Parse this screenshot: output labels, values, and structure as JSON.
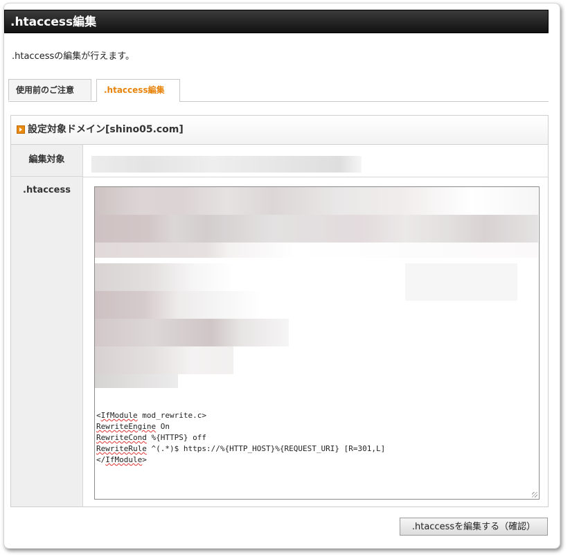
{
  "header": {
    "title": ".htaccess編集"
  },
  "description": ".htaccessの編集が行えます。",
  "tabs": [
    {
      "label": "使用前のご注意",
      "active": false
    },
    {
      "label": ".htaccess編集",
      "active": true
    }
  ],
  "panel": {
    "title": "設定対象ドメイン[shino05.com]",
    "rows": {
      "target_label": "編集対象",
      "htaccess_label": ".htaccess"
    }
  },
  "code": {
    "line1_tag": "IfModule",
    "line1_rest": " mod_rewrite.c>",
    "line2_kw": "RewriteEngine",
    "line2_rest": " On",
    "line3_kw": "RewriteCond",
    "line3_rest": " %{HTTPS} off",
    "line4_kw": "RewriteRule",
    "line4_rest": " ^(.*)$ https://%{HTTP_HOST}%{REQUEST_URI} [R=301,L]",
    "line5_tag": "IfModule"
  },
  "submit_label": ".htaccessを編集する（確認）",
  "colors": {
    "accent": "#e8840c",
    "header_bg": "#1a1a1a"
  }
}
